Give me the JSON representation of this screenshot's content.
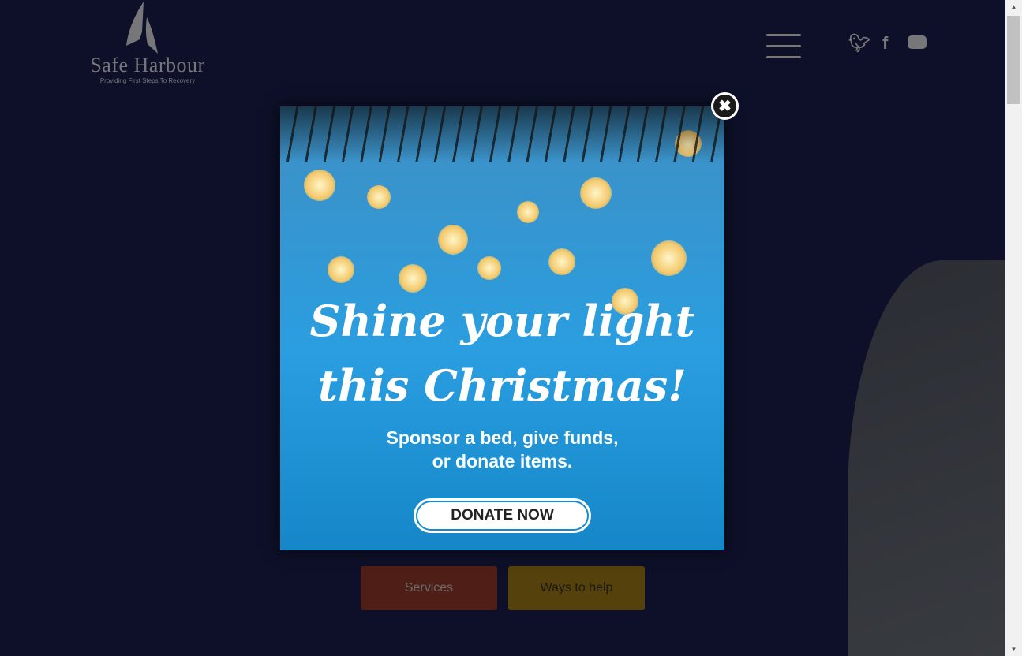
{
  "logo": {
    "name": "Safe Harbour",
    "tagline": "Providing First Steps To Recovery"
  },
  "social": [
    "twitter-icon",
    "facebook-icon",
    "youtube-icon"
  ],
  "buttons": {
    "services": "Services",
    "ways": "Ways to help"
  },
  "colors": {
    "services": "#4f1e17",
    "ways": "#54410b",
    "modal_blue": "#2a9ee0"
  },
  "popup": {
    "headline1": "Shine your light",
    "headline2": "this Christmas!",
    "subtext1": "Sponsor a bed, give funds,",
    "subtext2": "or donate items.",
    "donate": "DONATE NOW",
    "close": "✖"
  }
}
